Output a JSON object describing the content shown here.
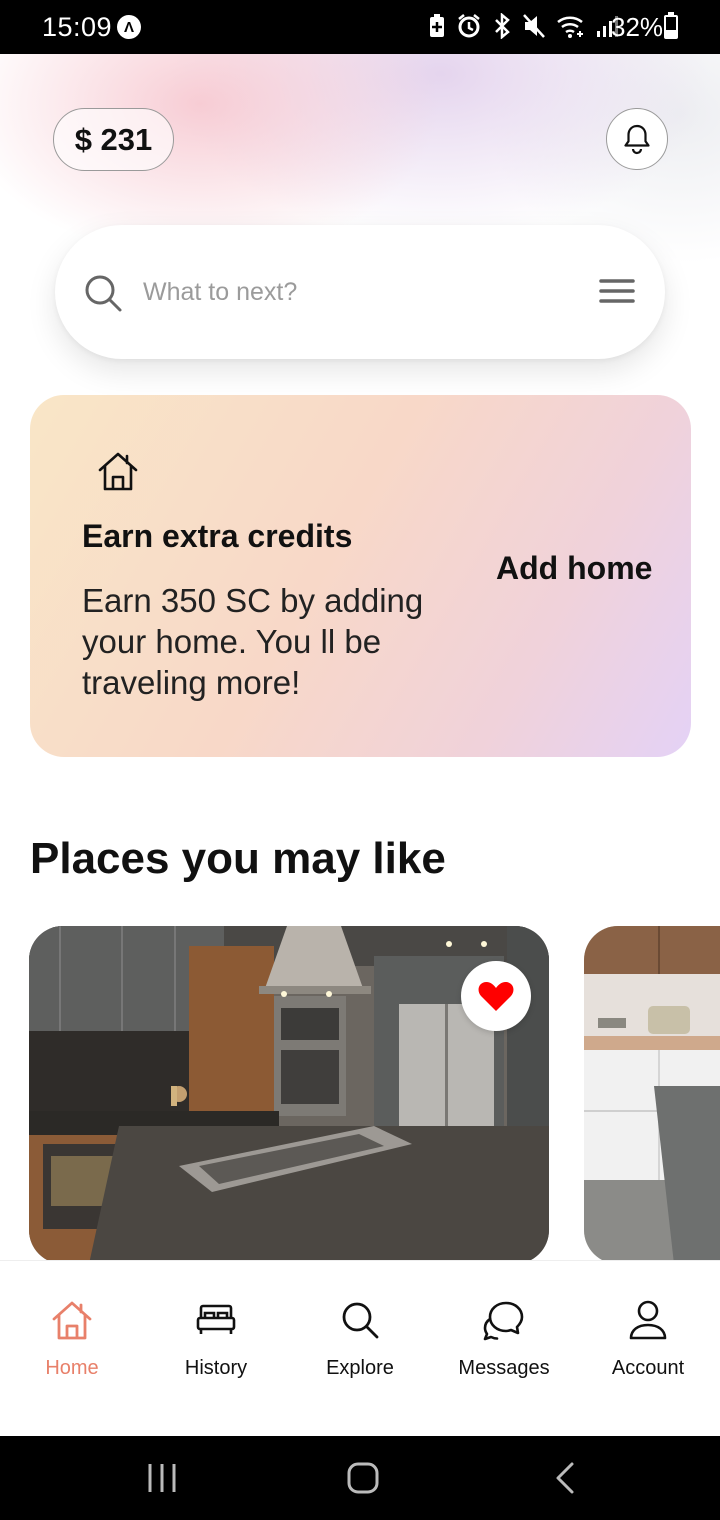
{
  "status_bar": {
    "time": "15:09",
    "notification_glyph": "Λ",
    "battery_percent": "32%",
    "icons": [
      "battery-saver-icon",
      "alarm-icon",
      "bluetooth-icon",
      "mute-icon",
      "wifi-icon",
      "signal-icon"
    ]
  },
  "header": {
    "credits": "$ 231",
    "notification_icon": "bell-icon"
  },
  "search": {
    "placeholder": "What to next?",
    "value": "",
    "filter_icon": "menu-icon"
  },
  "promo": {
    "icon": "house-icon",
    "title": "Earn extra credits",
    "text": "Earn 350 SC by adding your home. You ll be traveling more!",
    "action": "Add home"
  },
  "places": {
    "title": "Places you may like",
    "items": [
      {
        "image": "modern-kitchen-photo",
        "favorited": true,
        "heart_color": "#ff0000"
      },
      {
        "image": "white-kitchen-photo",
        "favorited": false
      }
    ]
  },
  "bottom_nav": {
    "active_color": "#e8806a",
    "items": [
      {
        "label": "Home",
        "icon": "home-icon",
        "active": true
      },
      {
        "label": "History",
        "icon": "bed-icon",
        "active": false
      },
      {
        "label": "Explore",
        "icon": "search-icon",
        "active": false
      },
      {
        "label": "Messages",
        "icon": "chat-icon",
        "active": false
      },
      {
        "label": "Account",
        "icon": "user-icon",
        "active": false
      }
    ]
  },
  "system_nav": {
    "buttons": [
      "recents-button",
      "home-button",
      "back-button"
    ]
  }
}
